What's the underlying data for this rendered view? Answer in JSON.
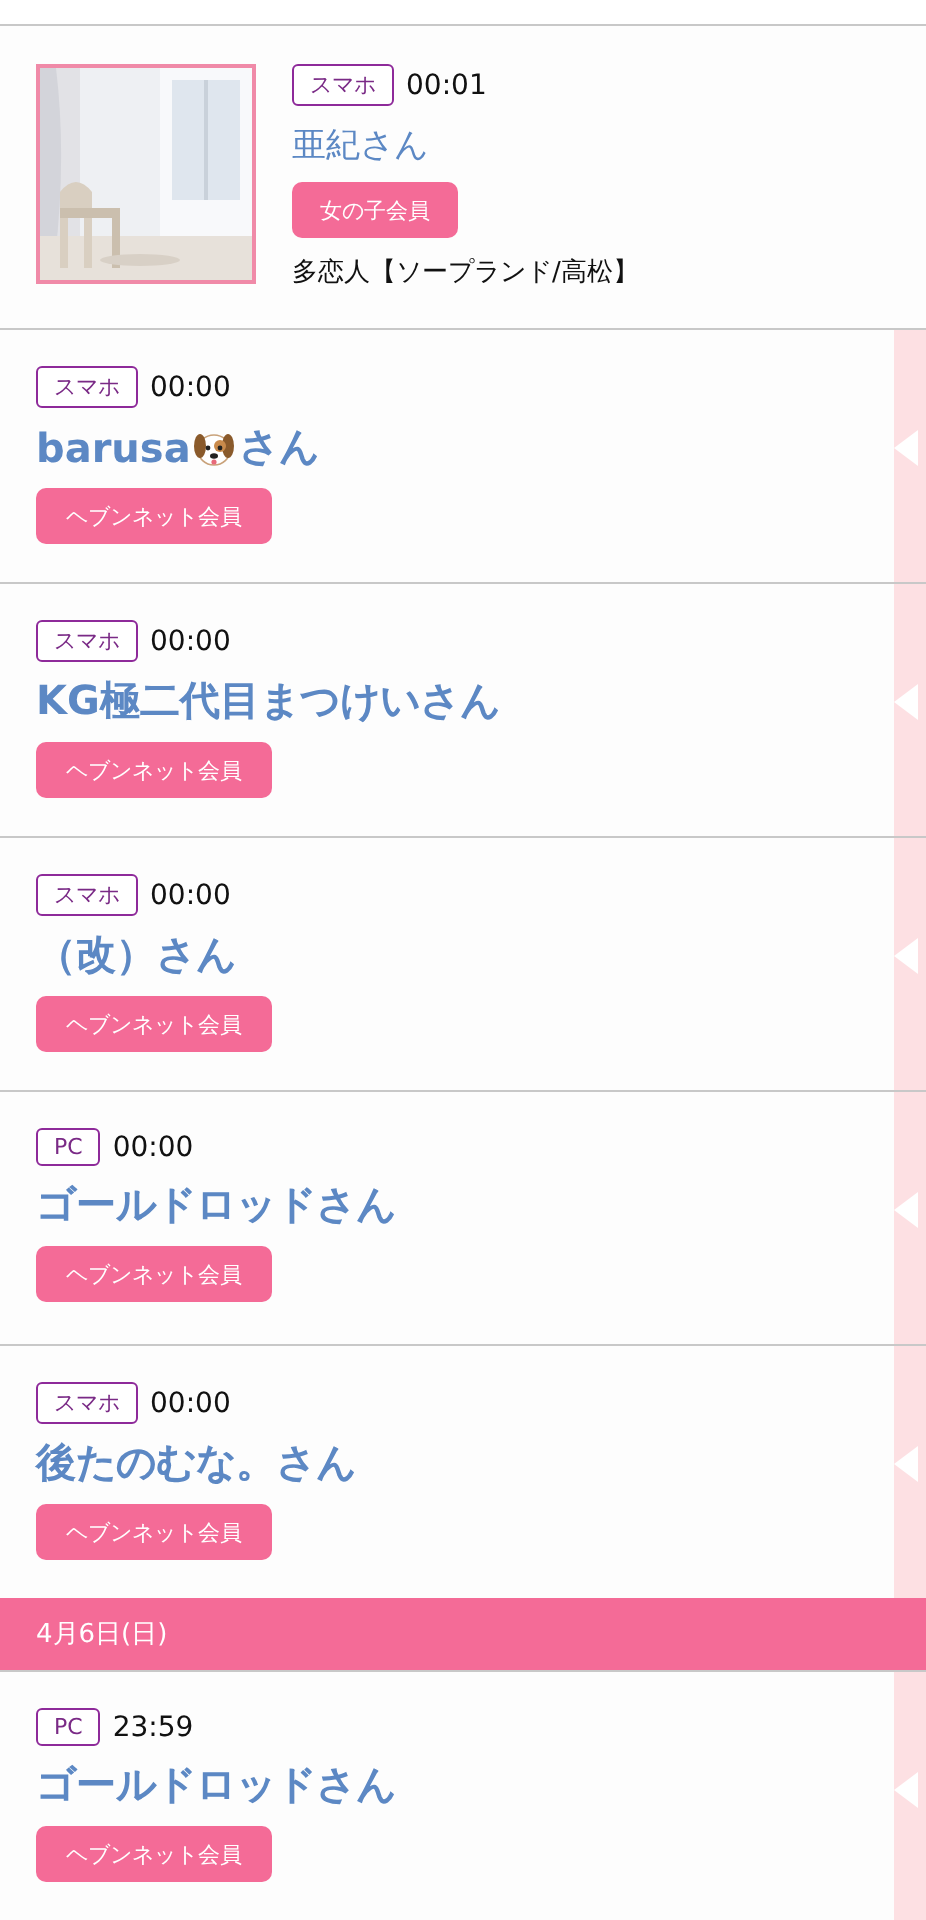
{
  "feed": [
    {
      "kind": "girl",
      "device": "スマホ",
      "time": "00:01",
      "name": "亜紀さん",
      "member": "女の子会員",
      "shop": "多恋人【ソープランド/高松】"
    },
    {
      "kind": "user",
      "device": "スマホ",
      "time": "00:00",
      "name_parts": [
        {
          "kind": "text",
          "text": "barusa"
        },
        {
          "kind": "emoji"
        },
        {
          "kind": "text",
          "text": "さん"
        }
      ],
      "member": "ヘブンネット会員"
    },
    {
      "kind": "user",
      "device": "スマホ",
      "time": "00:00",
      "name": "KG極二代目まつけいさん",
      "member": "ヘブンネット会員"
    },
    {
      "kind": "user",
      "device": "スマホ",
      "time": "00:00",
      "name": "（改）さん",
      "member": "ヘブンネット会員"
    },
    {
      "kind": "user",
      "device": "PC",
      "time": "00:00",
      "name": "ゴールドロッドさん",
      "member": "ヘブンネット会員"
    },
    {
      "kind": "user",
      "device": "スマホ",
      "time": "00:00",
      "name": "後たのむな。さん",
      "member": "ヘブンネット会員"
    },
    {
      "kind": "date",
      "label": "4月6日(日)"
    },
    {
      "kind": "user",
      "device": "PC",
      "time": "23:59",
      "name": "ゴールドロッドさん",
      "member": "ヘブンネット会員"
    }
  ]
}
